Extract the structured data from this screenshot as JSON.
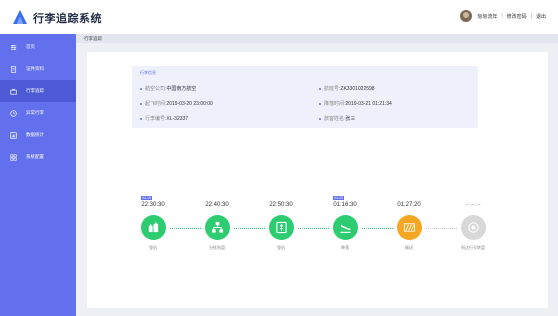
{
  "app": {
    "title": "行李追踪系统"
  },
  "header": {
    "user_name": "匆匆流年",
    "change_password": "修改密码",
    "separator": "|",
    "logout": "退出"
  },
  "sidebar": {
    "items": [
      {
        "label": "首页",
        "icon": "sliders-icon",
        "active": false
      },
      {
        "label": "证件资料",
        "icon": "document-icon",
        "active": false
      },
      {
        "label": "行李追踪",
        "icon": "suitcase-icon",
        "active": true
      },
      {
        "label": "异常行李",
        "icon": "clock-icon",
        "active": false
      },
      {
        "label": "数据统计",
        "icon": "bar-chart-icon",
        "active": false
      },
      {
        "label": "系统配置",
        "icon": "grid-icon",
        "active": false
      }
    ]
  },
  "tab": {
    "label": "行李追踪"
  },
  "info": {
    "title": "行李信息",
    "airline_label": "航空公司:",
    "airline_value": "中国南方航空",
    "flight_label": "航班号:",
    "flight_value": "ZK3301022598",
    "departure_label": "起飞时间:",
    "departure_value": "2019-03-20 23:00:00",
    "arrival_label": "降落时间:",
    "arrival_value": "2019-03-21 01:21:34",
    "baggage_label": "行李编号:",
    "baggage_value": "XL-32337",
    "owner_label": "旅客姓名:",
    "owner_value": "张三"
  },
  "timeline": {
    "steps": [
      {
        "date": "03-19",
        "time": "22:30:30",
        "label": "登机",
        "status": "done",
        "icon": "luggage-icon"
      },
      {
        "date": "",
        "time": "22:40:30",
        "label": "分拣到盘",
        "status": "done",
        "icon": "sorting-icon"
      },
      {
        "date": "",
        "time": "22:50:30",
        "label": "登机",
        "status": "done",
        "icon": "boarding-gate-icon"
      },
      {
        "date": "03-20",
        "time": "01:16:30",
        "label": "降落",
        "status": "done",
        "icon": "plane-landing-icon"
      },
      {
        "date": "",
        "time": "01:27:20",
        "label": "输送",
        "status": "current",
        "icon": "conveyor-icon"
      },
      {
        "date": "",
        "time": "--:--:--",
        "label": "到达行号转盘",
        "status": "pending",
        "icon": "carousel-icon"
      }
    ]
  },
  "colors": {
    "accent": "#6270ee",
    "success": "#2ecc71",
    "warning": "#f5a623",
    "pending": "#d8d8d8"
  }
}
